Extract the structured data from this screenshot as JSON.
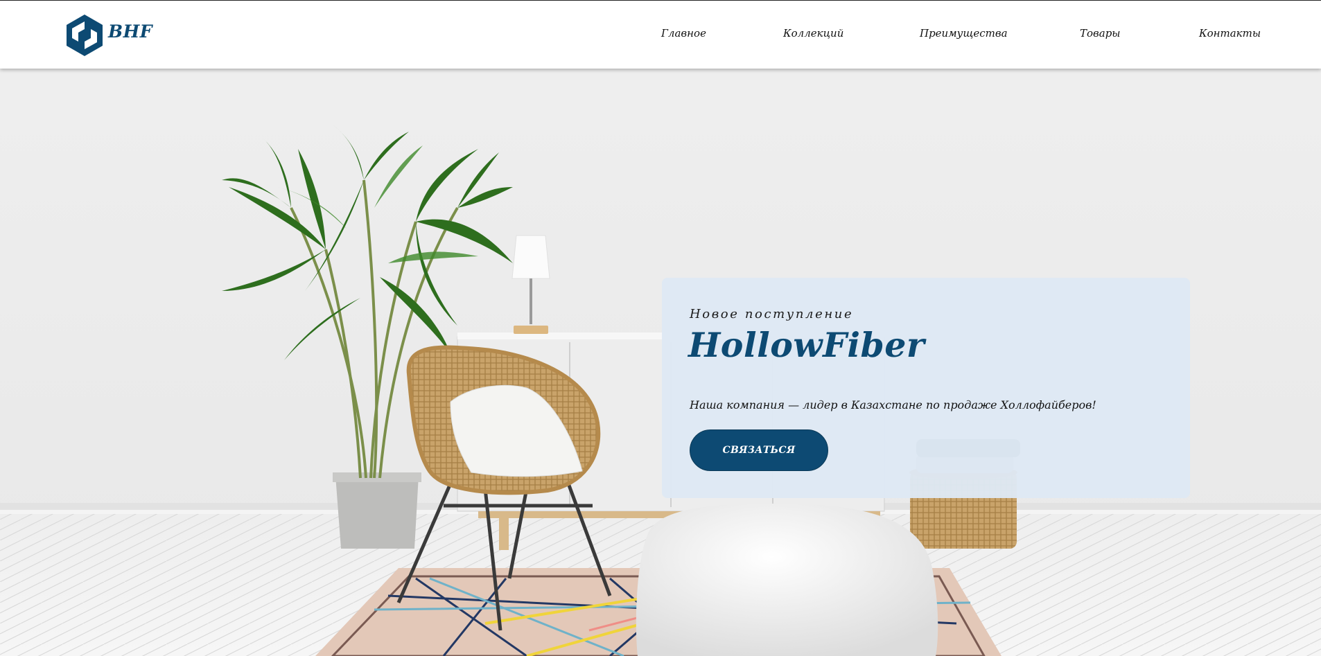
{
  "brand": {
    "name": "BHF",
    "logo_icon": "hexagon-cube-logo"
  },
  "nav": {
    "items": [
      {
        "label": "Главное"
      },
      {
        "label": "Коллекций"
      },
      {
        "label": "Преимущества"
      },
      {
        "label": "Товары"
      },
      {
        "label": "Контакты"
      }
    ]
  },
  "hero": {
    "kicker": "Новое поступление",
    "title": "HollowFiber",
    "text": "Наша компания — лидер в Казахстане по продаже Холлофайберов!",
    "button_label": "СВЯЗАТЬСЯ"
  },
  "colors": {
    "brand": "#0d4a73",
    "card_background": "#dee8f4",
    "header_background": "#ffffff",
    "wall": "#eceeef"
  }
}
